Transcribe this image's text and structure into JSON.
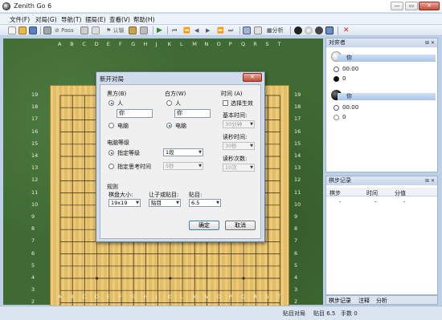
{
  "window": {
    "title": "Zenith Go 6",
    "min": "—",
    "max": "▭",
    "close": "✕"
  },
  "menu": [
    "文件(F)",
    "对局(G)",
    "导航(T)",
    "摆局(E)",
    "查看(V)",
    "帮助(H)"
  ],
  "toolbar": {
    "pass_label": "Pass",
    "resign_label": "认输",
    "analyze_label": "分析"
  },
  "board": {
    "columns": [
      "A",
      "B",
      "C",
      "D",
      "E",
      "F",
      "G",
      "H",
      "J",
      "K",
      "L",
      "M",
      "N",
      "O",
      "P",
      "Q",
      "R",
      "S",
      "T"
    ],
    "rows": [
      "19",
      "18",
      "17",
      "16",
      "15",
      "14",
      "13",
      "12",
      "11",
      "10",
      "9",
      "8",
      "7",
      "6",
      "5",
      "4",
      "3",
      "2",
      "1"
    ]
  },
  "dialog": {
    "title": "新开对局",
    "close": "✕",
    "black": {
      "heading": "黑方(B)",
      "human": "人",
      "name": "你",
      "computer": "电脑"
    },
    "white": {
      "heading": "白方(W)",
      "human": "人",
      "name": "你",
      "computer": "电脑"
    },
    "time": {
      "heading": "时间 (A)",
      "enable": "选择生效",
      "base_label": "基本时间:",
      "base_value": "30分钟",
      "byo_label": "读秒时间:",
      "byo_value": "30秒",
      "byo_count_label": "读秒次数:",
      "byo_count_value": "10次"
    },
    "level": {
      "heading": "电脑等级",
      "fixed": "指定等级",
      "fixed_value": "1段",
      "think": "指定思考时间",
      "think_value": "5秒"
    },
    "rules": {
      "heading": "规则",
      "size_label": "棋盘大小:",
      "size_value": "19x19",
      "handicap_label": "让子或贴目:",
      "handicap_value": "贴目",
      "komi_label": "贴目:",
      "komi_value": "6.5"
    },
    "ok": "确定",
    "cancel": "取消"
  },
  "players_panel": {
    "title": "对弈者",
    "white": {
      "name": "你",
      "time": "00:00",
      "captures": "0"
    },
    "black": {
      "name": "你",
      "time": "00:00",
      "captures": "0"
    }
  },
  "moves_panel": {
    "title": "棋步记录",
    "columns": [
      "棋步",
      "时间",
      "分值"
    ],
    "row": [
      "-",
      "-",
      "-"
    ]
  },
  "bottom_tabs": [
    "棋步记录",
    "注释",
    "分析"
  ],
  "status": {
    "mode": "贴目对局",
    "komi": "贴目 6.5",
    "moves": "手数 0"
  },
  "colors": {
    "board": "#e9c36a",
    "felt": "#3f6a34",
    "accent": "#1a4ea0"
  }
}
